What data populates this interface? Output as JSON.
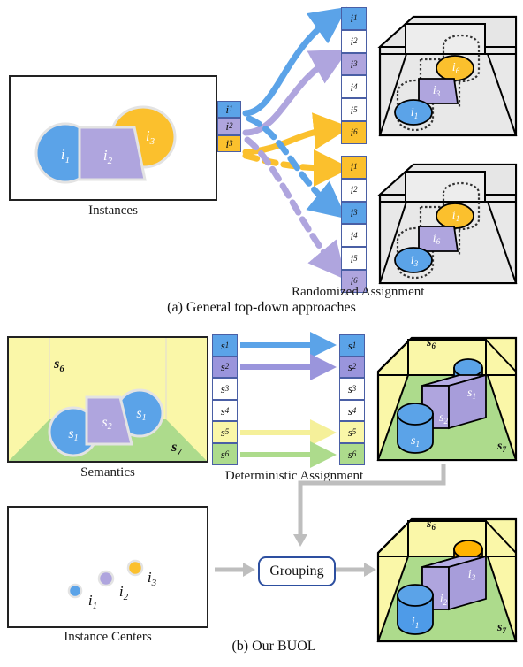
{
  "figure": {
    "part_a": {
      "caption": "(a) General top-down approaches",
      "assignment_label": "Randomized Assignment",
      "instances_panel": {
        "title": "Instances",
        "shapes": [
          {
            "name": "circle-i1",
            "label": "i",
            "sub": "1",
            "color": "#5BA3E8"
          },
          {
            "name": "trapezoid-i2",
            "label": "i",
            "sub": "2",
            "color": "#AFA5DE"
          },
          {
            "name": "circle-i3",
            "label": "i",
            "sub": "3",
            "color": "#FBC02D"
          }
        ]
      },
      "source_list": [
        {
          "label": "i",
          "sub": "1",
          "color": "#5BA3E8"
        },
        {
          "label": "i",
          "sub": "2",
          "color": "#AFA5DE"
        },
        {
          "label": "i",
          "sub": "3",
          "color": "#FBC02D"
        }
      ],
      "target_list_top": [
        {
          "label": "i",
          "sub": "1",
          "color": "#5BA3E8"
        },
        {
          "label": "i",
          "sub": "2",
          "color": "#FFFFFF"
        },
        {
          "label": "i",
          "sub": "3",
          "color": "#AFA5DE"
        },
        {
          "label": "i",
          "sub": "4",
          "color": "#FFFFFF"
        },
        {
          "label": "i",
          "sub": "5",
          "color": "#FFFFFF"
        },
        {
          "label": "i",
          "sub": "6",
          "color": "#FBC02D"
        }
      ],
      "target_list_bottom": [
        {
          "label": "i",
          "sub": "1",
          "color": "#FBC02D"
        },
        {
          "label": "i",
          "sub": "2",
          "color": "#FFFFFF"
        },
        {
          "label": "i",
          "sub": "3",
          "color": "#5BA3E8"
        },
        {
          "label": "i",
          "sub": "4",
          "color": "#FFFFFF"
        },
        {
          "label": "i",
          "sub": "5",
          "color": "#FFFFFF"
        },
        {
          "label": "i",
          "sub": "6",
          "color": "#AFA5DE"
        }
      ],
      "scene_top": {
        "name": "3d-room-top",
        "objects": [
          {
            "label": "i",
            "sub": "1",
            "color": "#5BA3E8",
            "shape": "ellipse"
          },
          {
            "label": "i",
            "sub": "3",
            "color": "#AFA5DE",
            "shape": "trapezoid"
          },
          {
            "label": "i",
            "sub": "6",
            "color": "#FBC02D",
            "shape": "ellipse"
          }
        ]
      },
      "scene_bottom": {
        "name": "3d-room-bottom",
        "objects": [
          {
            "label": "i",
            "sub": "3",
            "color": "#5BA3E8",
            "shape": "ellipse"
          },
          {
            "label": "i",
            "sub": "6",
            "color": "#AFA5DE",
            "shape": "trapezoid"
          },
          {
            "label": "i",
            "sub": "1",
            "color": "#FBC02D",
            "shape": "ellipse"
          }
        ]
      }
    },
    "part_b": {
      "caption": "(b) Our BUOL",
      "assignment_label": "Deterministic Assignment",
      "semantics_panel": {
        "title": "Semantics",
        "wall_label": {
          "label": "s",
          "sub": "6"
        },
        "floor_label": {
          "label": "s",
          "sub": "7"
        },
        "shapes": [
          {
            "name": "circle-s1-left",
            "label": "s",
            "sub": "1",
            "color": "#5BA3E8"
          },
          {
            "name": "trapezoid-s2",
            "label": "s",
            "sub": "2",
            "color": "#AFA5DE"
          },
          {
            "name": "circle-s1-right",
            "label": "s",
            "sub": "1",
            "color": "#5BA3E8"
          }
        ],
        "wall_color": "#FAF7A8",
        "floor_color": "#ADDB8C"
      },
      "source_list": [
        {
          "label": "s",
          "sub": "1",
          "color": "#5BA3E8"
        },
        {
          "label": "s",
          "sub": "2",
          "color": "#9A95DC"
        },
        {
          "label": "s",
          "sub": "3",
          "color": "#FFFFFF"
        },
        {
          "label": "s",
          "sub": "4",
          "color": "#FFFFFF"
        },
        {
          "label": "s",
          "sub": "5",
          "color": "#FAF7A8"
        },
        {
          "label": "s",
          "sub": "6",
          "color": "#ADDB8C"
        }
      ],
      "target_list": [
        {
          "label": "s",
          "sub": "1",
          "color": "#5BA3E8"
        },
        {
          "label": "s",
          "sub": "2",
          "color": "#9A95DC"
        },
        {
          "label": "s",
          "sub": "3",
          "color": "#FFFFFF"
        },
        {
          "label": "s",
          "sub": "4",
          "color": "#FFFFFF"
        },
        {
          "label": "s",
          "sub": "5",
          "color": "#FAF7A8"
        },
        {
          "label": "s",
          "sub": "6",
          "color": "#ADDB8C"
        }
      ],
      "centers_panel": {
        "title": "Instance Centers",
        "points": [
          {
            "label": "i",
            "sub": "1",
            "color": "#5BA3E8"
          },
          {
            "label": "i",
            "sub": "2",
            "color": "#AFA5DE"
          },
          {
            "label": "i",
            "sub": "3",
            "color": "#FBC02D"
          }
        ]
      },
      "grouping_button": "Grouping",
      "scene_semantic": {
        "name": "3d-room-semantic",
        "wall_label": {
          "label": "s",
          "sub": "6"
        },
        "floor_label": {
          "label": "s",
          "sub": "7"
        },
        "objects": [
          {
            "label": "s",
            "sub": "1",
            "color": "#5BA3E8",
            "shape": "cylinder"
          },
          {
            "label": "s",
            "sub": "2",
            "color": "#AFA5DE",
            "shape": "box"
          },
          {
            "label": "s",
            "sub": "1",
            "color": "#5BA3E8",
            "shape": "cylinder"
          }
        ]
      },
      "scene_result": {
        "name": "3d-room-result",
        "wall_label": {
          "label": "s",
          "sub": "6"
        },
        "floor_label": {
          "label": "s",
          "sub": "7"
        },
        "objects": [
          {
            "label": "i",
            "sub": "1",
            "color": "#5BA3E8",
            "shape": "cylinder"
          },
          {
            "label": "i",
            "sub": "2",
            "color": "#AFA5DE",
            "shape": "box"
          },
          {
            "label": "i",
            "sub": "3",
            "color": "#F5A800",
            "shape": "cylinder"
          }
        ]
      }
    },
    "colors": {
      "blue": "#5BA3E8",
      "purple": "#AFA5DE",
      "yellow": "#FBC02D",
      "orange": "#F5A800",
      "wall": "#FAF7A8",
      "floor": "#ADDB8C",
      "room_gray": "#E8E8E8",
      "arrow_gray": "#BEBEBE",
      "cell_border": "#4a5fa5"
    }
  }
}
